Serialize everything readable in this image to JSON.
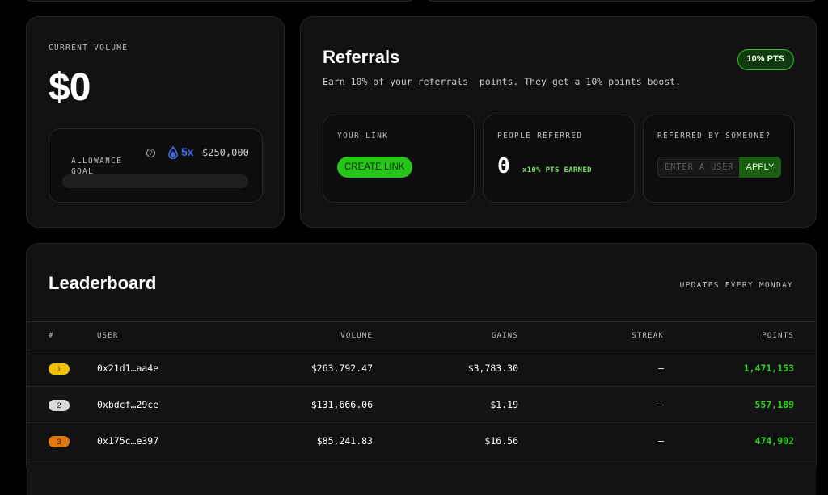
{
  "volume": {
    "label": "CURRENT VOLUME",
    "value": "$0",
    "allowance_label": "ALLOWANCE GOAL",
    "help_glyph": "?",
    "multiplier": "5x",
    "goal": "$250,000",
    "progress": 0,
    "multiplier_color": "#3b6df0"
  },
  "referrals": {
    "title": "Referrals",
    "description": "Earn 10% of your referrals' points. They get a 10% points boost.",
    "badge": "10% PTS",
    "your_link_label": "YOUR LINK",
    "create_link": "CREATE LINK",
    "people_label": "PEOPLE REFERRED",
    "people_count": "0",
    "people_earned": "x10% PTS EARNED",
    "refby_label": "REFERRED BY SOMEONE?",
    "refby_placeholder": "ENTER A USERNAME",
    "apply": "APPLY",
    "accent": "#27c41a"
  },
  "leaderboard": {
    "title": "Leaderboard",
    "updates": "UPDATES EVERY MONDAY",
    "columns": {
      "rank": "#",
      "user": "USER",
      "volume": "VOLUME",
      "gains": "GAINS",
      "streak": "STREAK",
      "points": "POINTS"
    },
    "rows": [
      {
        "rank": "1",
        "user": "0x21d1…aa4e",
        "volume": "$263,792.47",
        "gains": "$3,783.30",
        "streak": "–",
        "points": "1,471,153",
        "pill_color": "#f2c200",
        "pill_text": "#3a2c00"
      },
      {
        "rank": "2",
        "user": "0xbdcf…29ce",
        "volume": "$131,666.06",
        "gains": "$1.19",
        "streak": "–",
        "points": "557,189",
        "pill_color": "#d9d9d9",
        "pill_text": "#222222"
      },
      {
        "rank": "3",
        "user": "0x175c…e397",
        "volume": "$85,241.83",
        "gains": "$16.56",
        "streak": "–",
        "points": "474,902",
        "pill_color": "#e07a10",
        "pill_text": "#2a1300"
      }
    ]
  }
}
